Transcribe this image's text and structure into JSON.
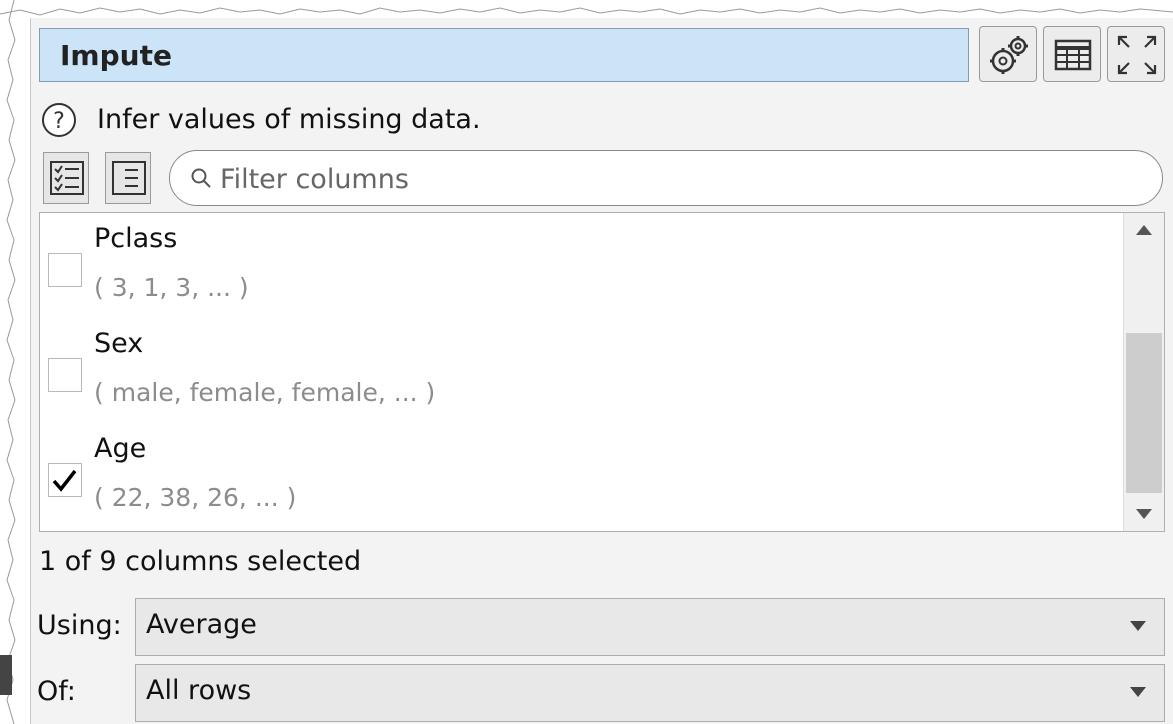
{
  "panel": {
    "title": "Impute",
    "description": "Infer values of missing data.",
    "icons": [
      "settings-gears-icon",
      "table-icon",
      "expand-icon",
      "help-icon",
      "select-all-icon",
      "select-none-icon",
      "search-icon"
    ]
  },
  "filter": {
    "placeholder": "Filter columns",
    "value": ""
  },
  "columns": [
    {
      "name": "Pclass",
      "sample": "( 3, 1, 3, ... )",
      "checked": false
    },
    {
      "name": "Sex",
      "sample": "( male, female, female, ... )",
      "checked": false
    },
    {
      "name": "Age",
      "sample": "( 22, 38, 26, ... )",
      "checked": true
    }
  ],
  "status": "1 of 9 columns selected",
  "using": {
    "label": "Using:",
    "value": "Average"
  },
  "of": {
    "label": "Of:",
    "value": "All rows"
  },
  "colors": {
    "title_bg": "#cce4f7",
    "panel_bg": "#f3f3f3",
    "sample_text": "#8c8c8c"
  }
}
